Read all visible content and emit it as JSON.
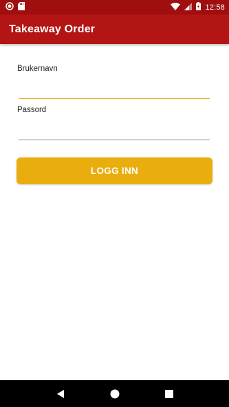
{
  "status_bar": {
    "time": "12:58",
    "icons": [
      "record-icon",
      "sd-card-icon",
      "wifi-icon",
      "signal-icon",
      "battery-icon"
    ]
  },
  "app_bar": {
    "title": "Takeaway Order"
  },
  "login_form": {
    "username_label": "Brukernavn",
    "username_value": "",
    "password_label": "Passord",
    "password_value": "",
    "login_button_label": "LOGG INN"
  },
  "nav_bar": {
    "icons": [
      "back-icon",
      "home-icon",
      "recents-icon"
    ]
  },
  "colors": {
    "status_bar": "#9f0f0f",
    "app_bar": "#b31414",
    "accent": "#e9ae0e"
  }
}
